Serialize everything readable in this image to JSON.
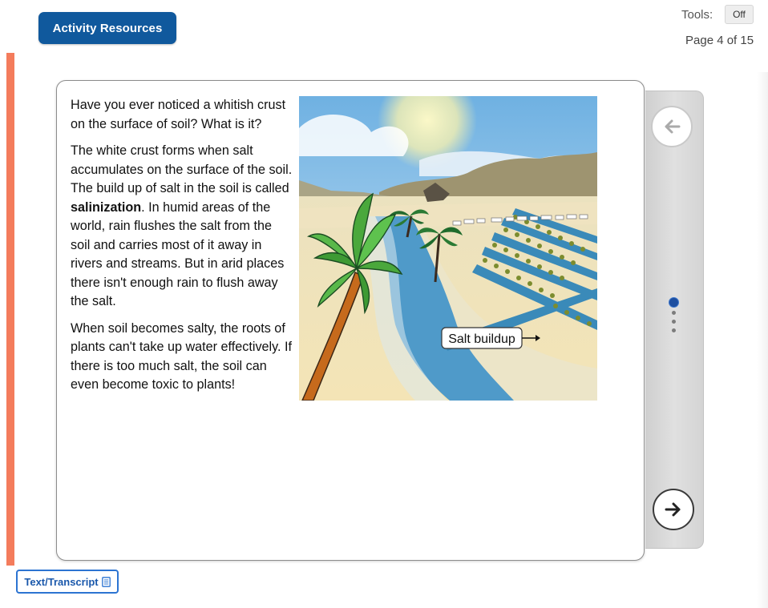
{
  "header": {
    "activity_resources_label": "Activity Resources",
    "tools_label": "Tools:",
    "tools_toggle": "Off",
    "page_indicator": "Page 4 of 15"
  },
  "content": {
    "paragraphs": {
      "p1": "Have you ever noticed a whitish crust on the surface of soil? What is it?",
      "p2_before": "The white crust forms when salt accumulates on the surface of the soil. The build up of salt in the soil is called ",
      "p2_bold": "salinization",
      "p2_after": ". In humid areas of the world, rain flushes the salt from the soil and carries most of it away in rivers and streams. But in arid places there isn't enough rain to flush away the salt.",
      "p3": "When soil becomes salty, the roots of plants can't take up water effectively. If there is too much salt, the soil can even become toxic to plants!"
    },
    "image_label": "Salt buildup"
  },
  "navigation": {
    "prev_icon": "arrow-left-icon",
    "next_icon": "arrow-right-icon",
    "current_dot_index": 0,
    "dot_count": 4
  },
  "footer": {
    "transcript_label": "Text/Transcript",
    "transcript_icon": "document-icon"
  },
  "colors": {
    "primary_blue": "#10599d",
    "accent_stripe": "#f47c5c",
    "transcript_blue": "#2c74d2",
    "active_dot": "#1e4fa0"
  }
}
